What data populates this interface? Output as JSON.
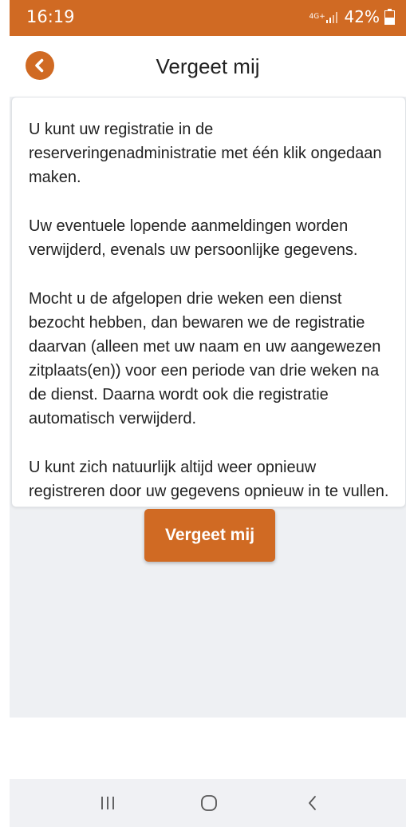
{
  "status_bar": {
    "time": "16:19",
    "network": "4G+",
    "battery": "42%",
    "color": "#d06a23"
  },
  "header": {
    "title": "Vergeet mij",
    "back_icon": "chevron-left-circle-icon"
  },
  "card": {
    "paragraphs": [
      "U kunt uw registratie in de reserveringenadministratie met één klik ongedaan maken.",
      "Uw eventuele lopende aanmeldingen worden verwijderd, evenals uw persoonlijke gegevens.",
      "Mocht u de afgelopen drie weken een dienst bezocht hebben, dan bewaren we de registratie daarvan (alleen met uw naam en uw aangewezen zitplaats(en)) voor een periode van drie weken na de dienst. Daarna wordt ook die registratie automatisch verwijderd.",
      "U kunt zich natuurlijk altijd weer opnieuw registreren door uw gegevens opnieuw in te vullen."
    ]
  },
  "actions": {
    "forget_label": "Vergeet mij"
  },
  "nav_bar": {
    "recents_icon": "recent-apps-icon",
    "home_icon": "home-icon",
    "back_icon": "back-icon"
  },
  "colors": {
    "accent": "#d06a23",
    "content_background": "#eef0f3"
  }
}
